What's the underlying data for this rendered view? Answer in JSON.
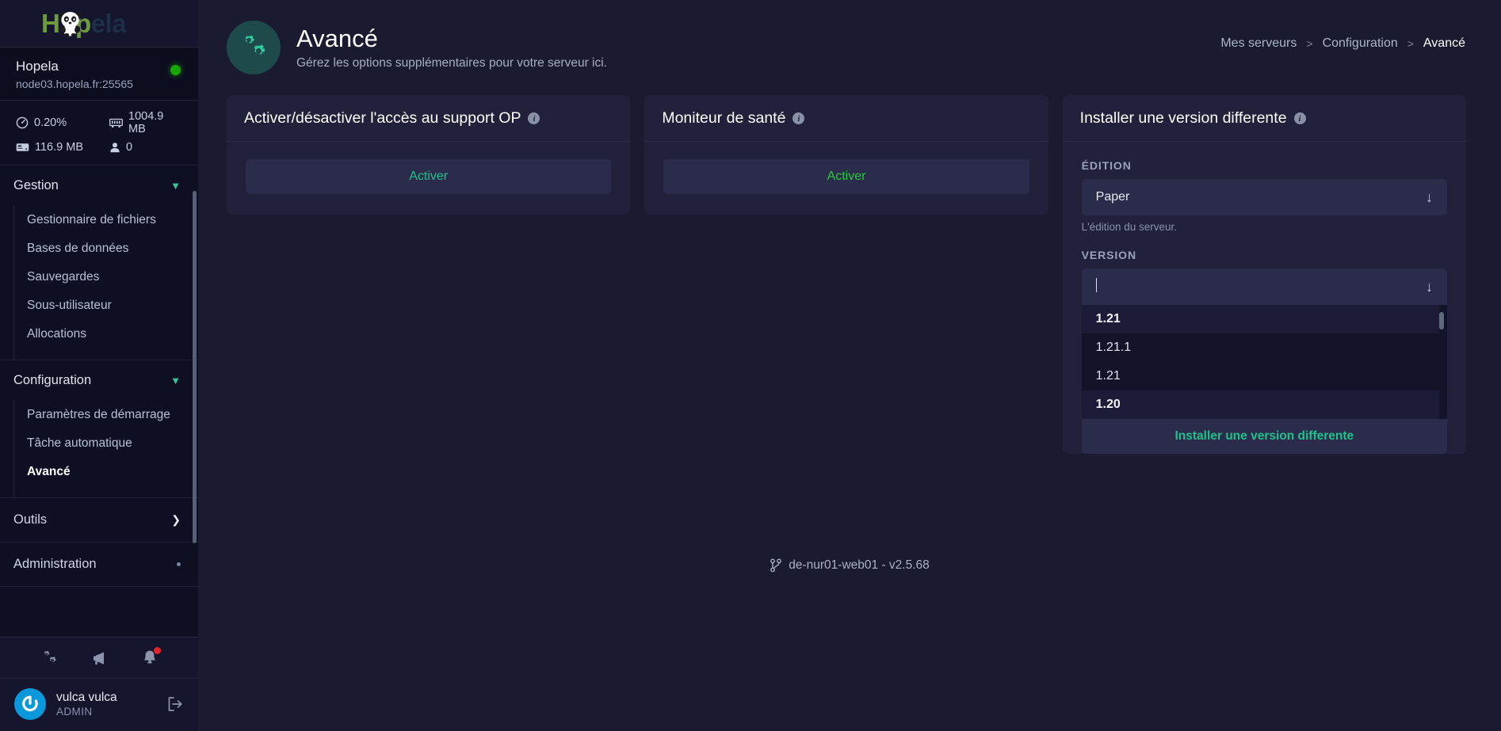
{
  "brand": {
    "logo_text": "Hopela",
    "logo_icon": "panda-icon"
  },
  "server": {
    "name": "Hopela",
    "host": "node03.hopela.fr:25565",
    "status": "online",
    "status_color": "#16a800",
    "stats": [
      {
        "icon": "gauge-icon",
        "value": "0.20%"
      },
      {
        "icon": "memory-icon",
        "value": "1004.9 MB"
      },
      {
        "icon": "harddrive-icon",
        "value": "116.9 MB"
      },
      {
        "icon": "user-icon",
        "value": "0"
      }
    ]
  },
  "sidebar": {
    "sections": [
      {
        "label": "Gestion",
        "expanded": true,
        "items": [
          "Gestionnaire de fichiers",
          "Bases de données",
          "Sauvegardes",
          "Sous-utilisateur",
          "Allocations"
        ]
      },
      {
        "label": "Configuration",
        "expanded": true,
        "items": [
          "Paramètres de démarrage",
          "Tâche automatique",
          "Avancé"
        ],
        "active_item": "Avancé"
      }
    ],
    "flat_items": [
      {
        "label": "Outils",
        "indicator": "chevron-right-icon"
      },
      {
        "label": "Administration",
        "indicator": "dot-icon"
      }
    ],
    "icon_row": [
      {
        "name": "settings-gears-icon"
      },
      {
        "name": "megaphone-icon"
      },
      {
        "name": "bell-icon",
        "badge": true
      }
    ],
    "user": {
      "name": "vulca vulca",
      "role": "ADMIN",
      "avatar_icon": "power-avatar-icon",
      "logout_icon": "logout-icon"
    }
  },
  "page": {
    "icon": "gears-icon",
    "title": "Avancé",
    "subtitle": "Gérez les options supplémentaires pour votre serveur ici.",
    "breadcrumb": [
      {
        "label": "Mes serveurs",
        "current": false
      },
      {
        "label": "Configuration",
        "current": false
      },
      {
        "label": "Avancé",
        "current": true
      }
    ],
    "breadcrumb_separator": ">"
  },
  "cards": {
    "op_support": {
      "title": "Activer/désactiver l'accès au support OP",
      "info_icon": "info-icon",
      "button_label": "Activer"
    },
    "health_monitor": {
      "title": "Moniteur de santé",
      "info_icon": "info-icon",
      "button_label": "Activer"
    },
    "install_version": {
      "title": "Installer une version differente",
      "info_icon": "info-icon",
      "edition_label": "ÉDITION",
      "edition_value": "Paper",
      "edition_help": "L'édition du serveur.",
      "version_label": "VERSION",
      "version_value": "",
      "version_placeholder": "",
      "dropdown_arrow": "arrow-down-icon",
      "options": [
        {
          "label": "1.21",
          "group": true
        },
        {
          "label": "1.21.1",
          "group": false
        },
        {
          "label": "1.21",
          "group": false
        },
        {
          "label": "1.20",
          "group": true
        }
      ],
      "install_button_label": "Installer une version differente"
    }
  },
  "footer": {
    "icon": "git-branch-icon",
    "text": "de-nur01-web01 - v2.5.68"
  },
  "colors": {
    "accent_teal": "#1ec28b",
    "accent_green": "#22cc3a",
    "sidebar_bg": "#0f0f23",
    "main_bg": "#1a1a31",
    "card_bg": "#21213c"
  }
}
